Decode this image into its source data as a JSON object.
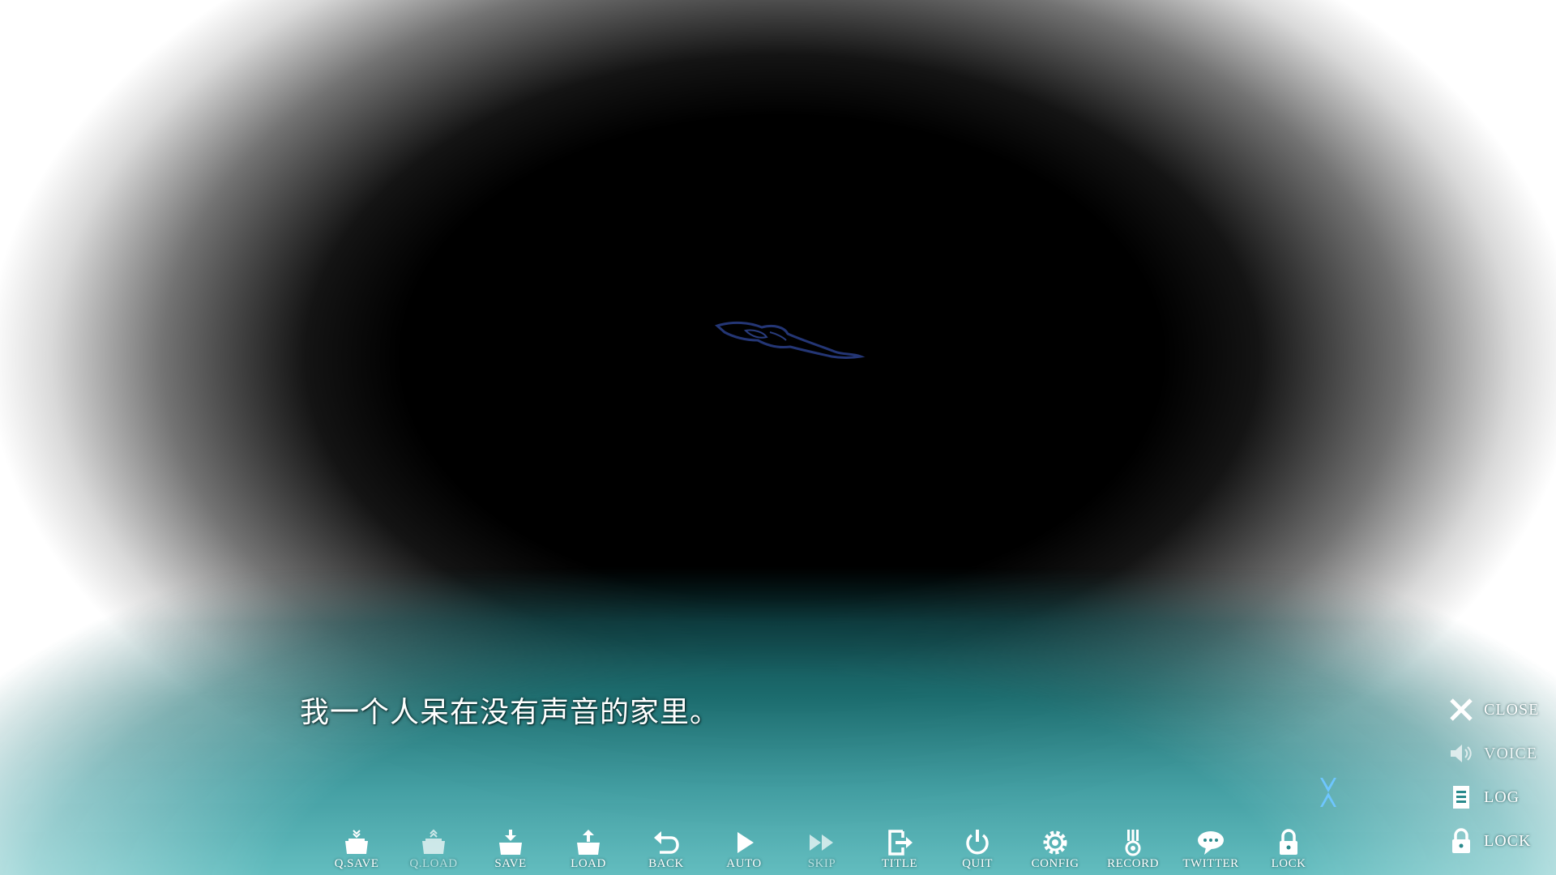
{
  "dialogue": {
    "text": "我一个人呆在没有声音的家里。"
  },
  "toolbar": {
    "qsave": "Q.SAVE",
    "qload": "Q.LOAD",
    "save": "SAVE",
    "load": "LOAD",
    "back": "BACK",
    "auto": "AUTO",
    "skip": "SKIP",
    "title": "TITLE",
    "quit": "QUIT",
    "config": "CONFIG",
    "record": "RECORD",
    "twitter": "TWITTER",
    "lock": "LOCK"
  },
  "side_menu": {
    "close": "CLOSE",
    "voice": "VOICE",
    "log": "LOG",
    "lock": "LOCK"
  },
  "colors": {
    "panel_teal": "#1a6e70",
    "text": "#ffffff",
    "indicator_blue": "#6ec6ff"
  },
  "icons": {
    "qsave": "qsave-icon",
    "qload": "qload-icon",
    "save": "save-icon",
    "load": "load-icon",
    "back": "back-icon",
    "auto": "play-icon",
    "skip": "fast-forward-icon",
    "title": "exit-to-title-icon",
    "quit": "power-icon",
    "config": "gear-icon",
    "record": "medal-icon",
    "twitter": "speech-bubble-icon",
    "lock": "padlock-icon",
    "close": "close-icon",
    "voice": "speaker-icon",
    "log": "log-list-icon",
    "side_lock": "padlock-icon"
  }
}
